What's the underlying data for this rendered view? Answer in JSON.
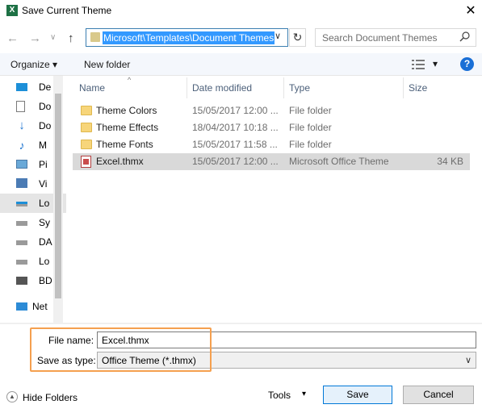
{
  "window": {
    "title": "Save Current Theme",
    "app_icon_letter": "X",
    "close_glyph": "✕"
  },
  "nav": {
    "back": "←",
    "forward": "→",
    "dropdown": "∨",
    "up": "↑",
    "address": "Microsoft\\Templates\\Document Themes",
    "address_dropdown": "∨",
    "refresh": "↻",
    "search_placeholder": "Search Document Themes"
  },
  "toolbar": {
    "organize": "Organize ▾",
    "new_folder": "New folder",
    "view_dropdown": "▾",
    "help": "?"
  },
  "sidebar": {
    "items": [
      {
        "label": "De",
        "icon": "desktop-icon"
      },
      {
        "label": "Do",
        "icon": "documents-icon"
      },
      {
        "label": "Do",
        "icon": "downloads-icon"
      },
      {
        "label": "M",
        "icon": "music-icon"
      },
      {
        "label": "Pi",
        "icon": "pictures-icon"
      },
      {
        "label": "Vi",
        "icon": "videos-icon"
      },
      {
        "label": "Lo",
        "icon": "local-disk-icon"
      },
      {
        "label": "Sy",
        "icon": "drive-icon"
      },
      {
        "label": "DA",
        "icon": "drive-icon"
      },
      {
        "label": "Lo",
        "icon": "drive-icon"
      },
      {
        "label": "BD",
        "icon": "optical-drive-icon"
      },
      {
        "label": "Net",
        "icon": "network-icon"
      }
    ]
  },
  "columns": {
    "name": "Name",
    "date": "Date modified",
    "type": "Type",
    "size": "Size",
    "sort_indicator": "^"
  },
  "files": [
    {
      "name": "Theme Colors",
      "date": "15/05/2017 12:00 ...",
      "type": "File folder",
      "size": "",
      "kind": "folder"
    },
    {
      "name": "Theme Effects",
      "date": "18/04/2017 10:18 ...",
      "type": "File folder",
      "size": "",
      "kind": "folder"
    },
    {
      "name": "Theme Fonts",
      "date": "15/05/2017 11:58 ...",
      "type": "File folder",
      "size": "",
      "kind": "folder"
    },
    {
      "name": "Excel.thmx",
      "date": "15/05/2017 12:00 ...",
      "type": "Microsoft Office Theme",
      "size": "34 KB",
      "kind": "file"
    }
  ],
  "form": {
    "filename_label": "File name:",
    "filename_value": "Excel.thmx",
    "savetype_label": "Save as type:",
    "savetype_value": "Office Theme (*.thmx)",
    "dropdown_glyph": "∨"
  },
  "footer": {
    "hide_folders": "Hide Folders",
    "hide_icon_glyph": "▲",
    "tools": "Tools",
    "tools_dropdown": "▾",
    "save": "Save",
    "cancel": "Cancel"
  },
  "colors": {
    "selection": "#3399ff",
    "highlight_box": "#f5a04f",
    "primary_border": "#0078d7"
  }
}
